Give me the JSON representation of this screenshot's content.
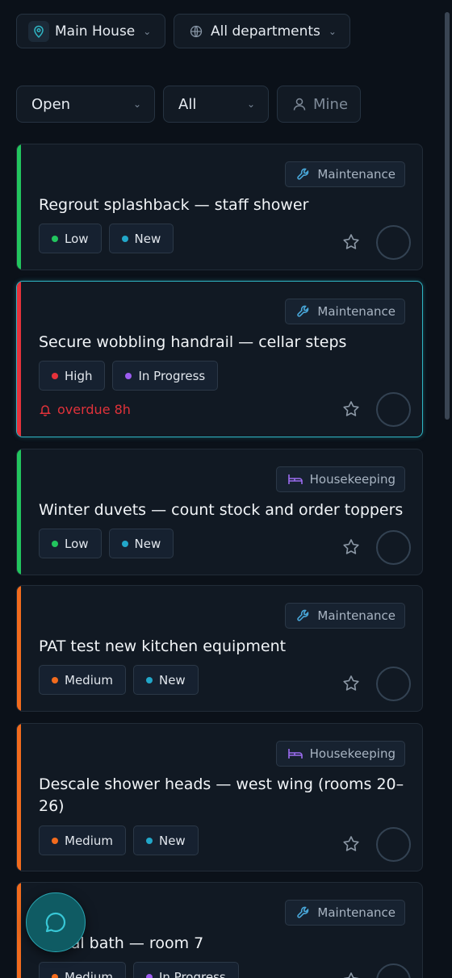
{
  "header": {
    "location": "Main House",
    "department_filter": "All departments"
  },
  "filters": {
    "status": "Open",
    "scope": "All",
    "mine": "Mine"
  },
  "tasks": [
    {
      "department": "Maintenance",
      "department_icon": "wrench-icon",
      "title": "Regrout splashback — staff shower",
      "priority": "Low",
      "priority_color": "#22c55e",
      "status": "New",
      "status_color": "#22a7c9",
      "accent_color": "#22c55e",
      "overdue": ""
    },
    {
      "department": "Maintenance",
      "department_icon": "wrench-icon",
      "title": "Secure wobbling handrail — cellar steps",
      "priority": "High",
      "priority_color": "#e5323b",
      "status": "In Progress",
      "status_color": "#9c5cf0",
      "accent_color": "#e5323b",
      "overdue": "overdue 8h"
    },
    {
      "department": "Housekeeping",
      "department_icon": "bed-icon",
      "title": "Winter duvets — count stock and order toppers",
      "priority": "Low",
      "priority_color": "#22c55e",
      "status": "New",
      "status_color": "#22a7c9",
      "accent_color": "#22c55e",
      "overdue": ""
    },
    {
      "department": "Maintenance",
      "department_icon": "wrench-icon",
      "title": "PAT test new kitchen equipment",
      "priority": "Medium",
      "priority_color": "#f26b1d",
      "status": "New",
      "status_color": "#22a7c9",
      "accent_color": "#f26b1d",
      "overdue": ""
    },
    {
      "department": "Housekeeping",
      "department_icon": "bed-icon",
      "title_line1": "Descale shower heads — west wing (rooms 20–",
      "title_line2": "26)",
      "priority": "Medium",
      "priority_color": "#f26b1d",
      "status": "New",
      "status_color": "#22a7c9",
      "accent_color": "#f26b1d",
      "overdue": ""
    },
    {
      "department": "Maintenance",
      "department_icon": "wrench-icon",
      "title": "…eal bath — room 7",
      "priority": "Medium",
      "priority_color": "#f26b1d",
      "status": "In Progress",
      "status_color": "#9c5cf0",
      "accent_color": "#f26b1d",
      "overdue": ""
    }
  ],
  "colors": {
    "background": "#0b1119",
    "card": "#111923",
    "selected_border": "#2fb5c4",
    "maintenance_icon": "#48a6d8",
    "housekeeping_icon": "#9b6cf0",
    "overdue": "#e0323a"
  },
  "fab_icon": "chat-icon"
}
